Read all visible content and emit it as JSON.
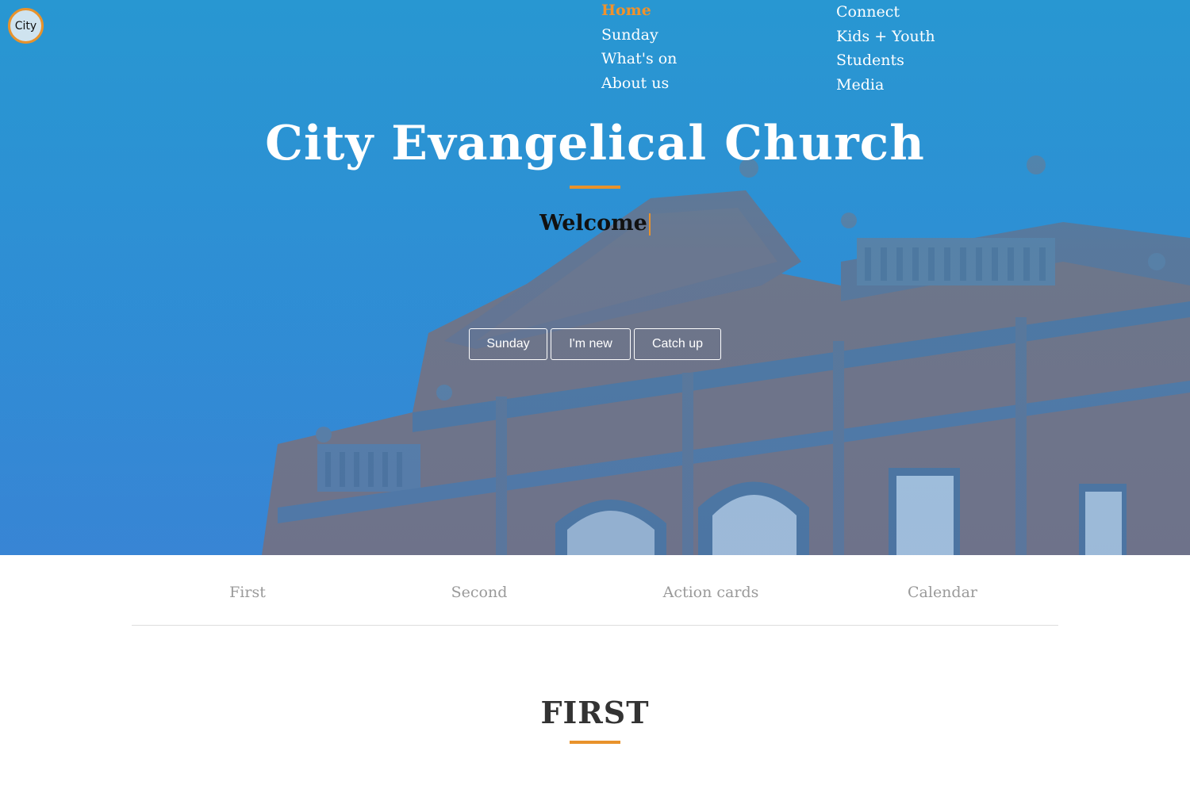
{
  "logo": {
    "text": "City"
  },
  "nav": {
    "col1": [
      "Home",
      "Sunday",
      "What's on",
      "About us"
    ],
    "col2": [
      "Connect",
      "Kids + Youth",
      "Students",
      "Media"
    ],
    "active": "Home"
  },
  "hero": {
    "title": "City Evangelical Church",
    "subtitle": "Welcome",
    "buttons": [
      "Sunday",
      "I'm new",
      "Catch up"
    ]
  },
  "tabs": [
    "First",
    "Second",
    "Action cards",
    "Calendar"
  ],
  "section": {
    "title": "FIRST"
  },
  "colors": {
    "accent": "#e8922b",
    "hero_blue": "#2898d2",
    "tab_text": "#9a9a9a"
  }
}
